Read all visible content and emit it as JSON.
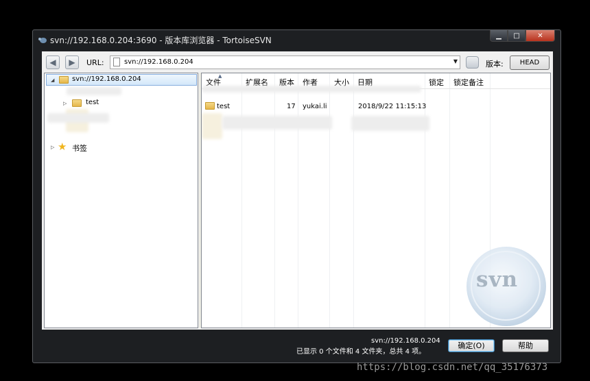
{
  "window": {
    "title": "svn://192.168.0.204:3690 - 版本库浏览器 - TortoiseSVN"
  },
  "controls": {
    "minimize": "▁",
    "maximize": "□",
    "close": "✕"
  },
  "toolbar": {
    "url_label": "URL:",
    "url_value": "svn://192.168.0.204",
    "revision_label": "版本:",
    "revision_button": "HEAD"
  },
  "tree": {
    "root_label": "svn://192.168.0.204",
    "child_label": "test",
    "bookmarks_label": "书签"
  },
  "list": {
    "columns": [
      "文件",
      "扩展名",
      "版本",
      "作者",
      "大小",
      "日期",
      "锁定",
      "锁定备注"
    ],
    "rows": [
      {
        "name": "test",
        "ext": "",
        "revision": "17",
        "author": "yukai.li",
        "size": "",
        "date": "2018/9/22 11:15:13"
      }
    ],
    "logo_text": "svn"
  },
  "status": {
    "url": "svn://192.168.0.204",
    "summary": "已显示 0 个文件和 4 文件夹，总共 4 项。"
  },
  "buttons": {
    "ok": "确定(O)",
    "help": "帮助"
  },
  "watermark": "https://blog.csdn.net/qq_35176373"
}
